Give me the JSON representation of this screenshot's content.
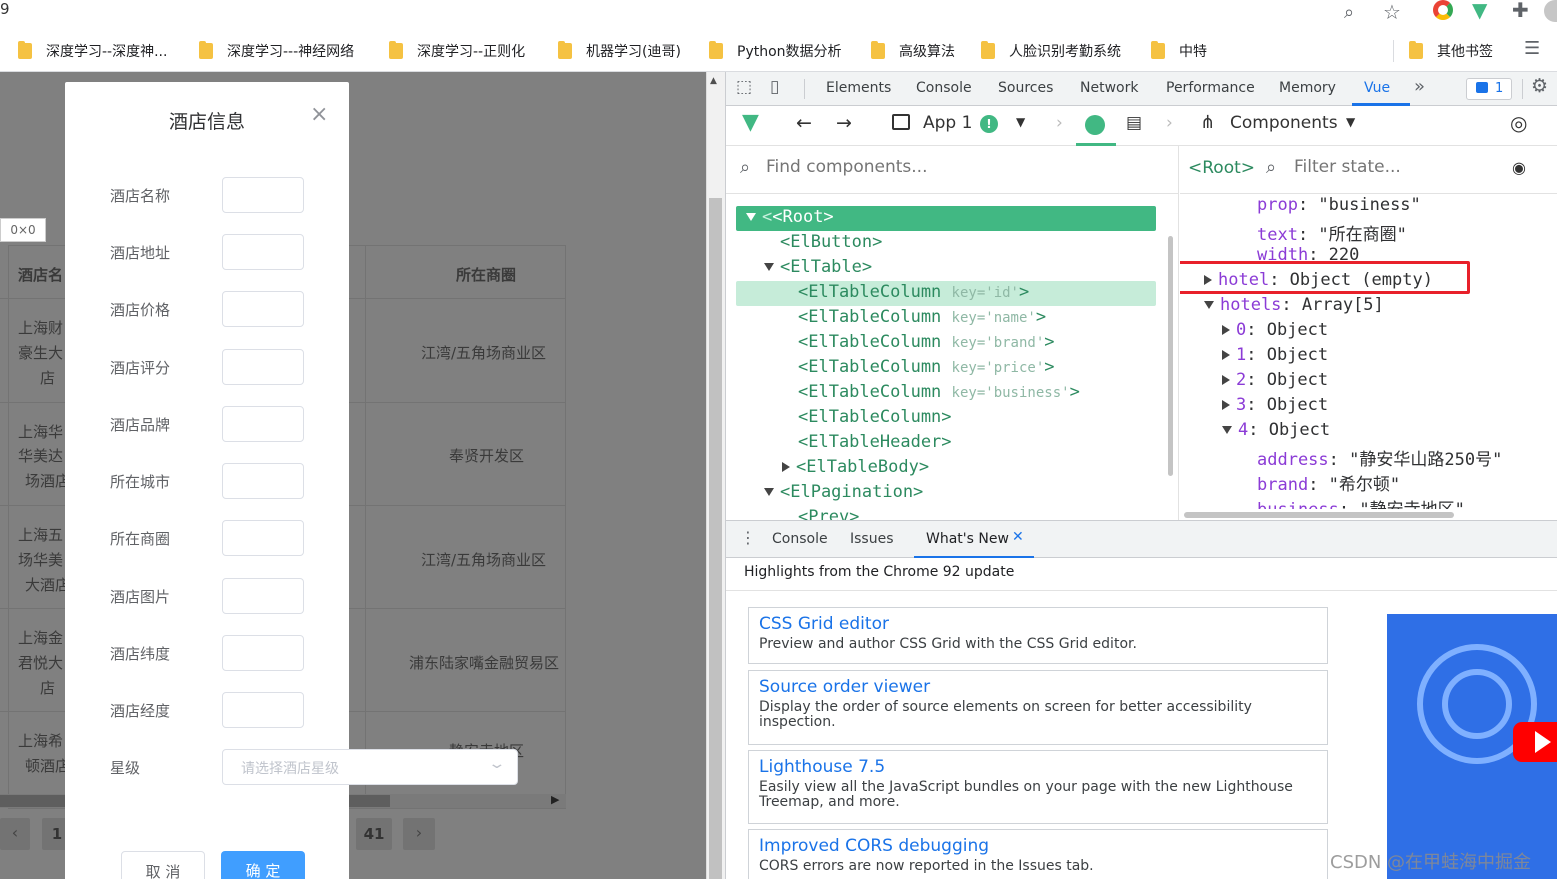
{
  "browser": {
    "tab_fragment": "9",
    "bookmarks": [
      "深度学习--深度神...",
      "深度学习---神经网络",
      "深度学习--正则化",
      "机器学习(迪哥)",
      "Python数据分析",
      "高级算法",
      "人脸识别考勤系统",
      "中特",
      "其他书签"
    ]
  },
  "app": {
    "coord_badge": "0×0",
    "table_headers": [
      "酒店名",
      "所在商圈"
    ],
    "rows": [
      {
        "name": [
          "上海财",
          "豪生大",
          "店"
        ],
        "business": "江湾/五角场商业区"
      },
      {
        "name": [
          "上海华",
          "华美达",
          "场酒店"
        ],
        "business": "奉贤开发区"
      },
      {
        "name": [
          "上海五",
          "场华美",
          "大酒店"
        ],
        "business": "江湾/五角场商业区"
      },
      {
        "name": [
          "上海金",
          "君悦大",
          "店"
        ],
        "business": "浦东陆家嘴金融贸易区"
      },
      {
        "name": [
          "上海希",
          "顿酒店"
        ],
        "business": "静安寺地区"
      }
    ],
    "pagination": {
      "first": "1",
      "last": "41",
      "prev": "‹",
      "next": "›"
    }
  },
  "dialog": {
    "title": "酒店信息",
    "close": "×",
    "fields": [
      "酒店名称",
      "酒店地址",
      "酒店价格",
      "酒店评分",
      "酒店品牌",
      "所在城市",
      "所在商圈",
      "酒店图片",
      "酒店纬度",
      "酒店经度"
    ],
    "star_label": "星级",
    "star_placeholder": "请选择酒店星级",
    "cancel": "取 消",
    "confirm": "确 定"
  },
  "devtools": {
    "tabs": [
      "Elements",
      "Console",
      "Sources",
      "Network",
      "Performance",
      "Memory",
      "Vue"
    ],
    "more": "»",
    "issues_count": "1",
    "vue_toolbar": {
      "app": "App 1",
      "components": "Components"
    },
    "find_placeholder": "Find components...",
    "root_crumb": "<Root>",
    "filter_placeholder": "Filter state...",
    "tree": [
      {
        "tag": "<Root>",
        "attr": ""
      },
      {
        "tag": "<ElButton>",
        "attr": ""
      },
      {
        "tag": "<ElTable>",
        "attr": ""
      },
      {
        "tag": "<ElTableColumn",
        "attr": "key='id'"
      },
      {
        "tag": "<ElTableColumn",
        "attr": "key='name'"
      },
      {
        "tag": "<ElTableColumn",
        "attr": "key='brand'"
      },
      {
        "tag": "<ElTableColumn",
        "attr": "key='price'"
      },
      {
        "tag": "<ElTableColumn",
        "attr": "key='business'"
      },
      {
        "tag": "<ElTableColumn>",
        "attr": ""
      },
      {
        "tag": "<ElTableHeader>",
        "attr": ""
      },
      {
        "tag": "<ElTableBody>",
        "attr": ""
      },
      {
        "tag": "<ElPagination>",
        "attr": ""
      },
      {
        "tag": "<Prev>",
        "attr": ""
      }
    ],
    "state": [
      {
        "key": "prop",
        "value": ": \"business\""
      },
      {
        "key": "text",
        "value": ": \"所在商圈\""
      },
      {
        "key": "width",
        "value": ": 220"
      },
      {
        "key": "hotel",
        "value": ": Object (empty)"
      },
      {
        "key": "hotels",
        "value": ": Array[5]"
      },
      {
        "key": "0",
        "value": ": Object"
      },
      {
        "key": "1",
        "value": ": Object"
      },
      {
        "key": "2",
        "value": ": Object"
      },
      {
        "key": "3",
        "value": ": Object"
      },
      {
        "key": "4",
        "value": ": Object"
      },
      {
        "key": "address",
        "value": ": \"静安华山路250号\""
      },
      {
        "key": "brand",
        "value": ": \"希尔顿\""
      },
      {
        "key": "business",
        "value": ": \"静安寺地区\""
      }
    ],
    "drawer_tabs": [
      "Console",
      "Issues",
      "What's New"
    ],
    "highlight": "Highlights from the Chrome 92 update",
    "cards": [
      {
        "title": "CSS Grid editor",
        "desc": "Preview and author CSS Grid with the CSS Grid editor."
      },
      {
        "title": "Source order viewer",
        "desc": "Display the order of source elements on screen for better accessibility inspection."
      },
      {
        "title": "Lighthouse 7.5",
        "desc": "Easily view all the JavaScript bundles on your page with the new Lighthouse Treemap, and more."
      },
      {
        "title": "Improved CORS debugging",
        "desc": "CORS errors are now reported in the Issues tab."
      }
    ]
  },
  "watermark": "CSDN @在甲蛙海中掘金",
  "colors": {
    "vue_green": "#41b883",
    "accent_blue": "#409eff",
    "highlight_red": "#e8202a"
  }
}
